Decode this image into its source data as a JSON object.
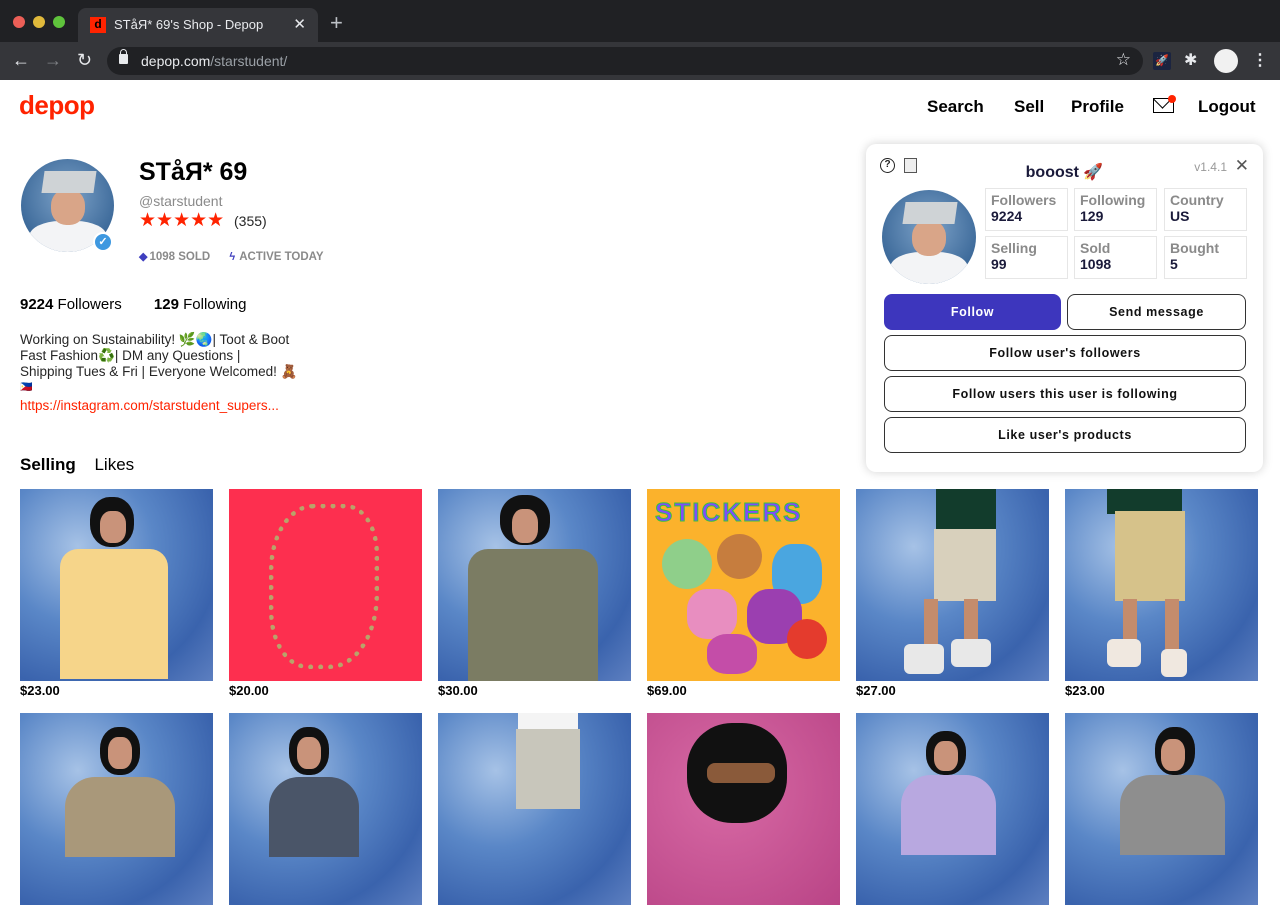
{
  "browser": {
    "tab_title": "STåЯ* 69's Shop - Depop",
    "favicon_letter": "d",
    "url_domain": "depop.com",
    "url_path": "/starstudent/"
  },
  "nav": {
    "logo": "depop",
    "search": "Search",
    "sell": "Sell",
    "profile": "Profile",
    "logout": "Logout",
    "has_unread_messages": true
  },
  "profile": {
    "name": "STåЯ* 69",
    "handle": "@starstudent",
    "rating_stars": 5,
    "stars_display": "★★★★★",
    "reviews": "(355)",
    "sold_badge": "1098 SOLD",
    "active_badge": "ACTIVE TODAY",
    "followers_count": "9224",
    "followers_label": "Followers",
    "following_count": "129",
    "following_label": "Following",
    "bio_lines": [
      "Working on Sustainability! 🌿🌏| Toot & Boot",
      "Fast Fashion♻️| DM any Questions |",
      "Shipping Tues & Fri | Everyone Welcomed! 🧸",
      "🇵🇭"
    ],
    "bio_link": "https://instagram.com/starstudent_supers..."
  },
  "tabs": {
    "selling": "Selling",
    "likes": "Likes"
  },
  "products": [
    {
      "price": "$23.00",
      "image": "floral shirt on blue backdrop"
    },
    {
      "price": "$20.00",
      "image": "chain necklace on red backdrop"
    },
    {
      "price": "$30.00",
      "image": "camo jacket on blue backdrop"
    },
    {
      "price": "$69.00",
      "image": "stickers on orange backdrop"
    },
    {
      "price": "$27.00",
      "image": "cargo shorts on blue backdrop"
    },
    {
      "price": "$23.00",
      "image": "khaki shorts on blue backdrop"
    },
    {
      "price": "",
      "image": "knit sweater on blue backdrop"
    },
    {
      "price": "",
      "image": "grey tee on blue backdrop"
    },
    {
      "price": "",
      "image": "trousers on blue backdrop"
    },
    {
      "price": "",
      "image": "sunglasses on pink backdrop"
    },
    {
      "price": "",
      "image": "lavender sweatshirt on blue backdrop"
    },
    {
      "price": "",
      "image": "grey sweatshirt on blue backdrop"
    }
  ],
  "extension": {
    "title": "booost 🚀",
    "version": "v1.4.1",
    "stats": [
      {
        "label": "Followers",
        "value": "9224"
      },
      {
        "label": "Following",
        "value": "129"
      },
      {
        "label": "Country",
        "value": "US"
      },
      {
        "label": "Selling",
        "value": "99"
      },
      {
        "label": "Sold",
        "value": "1098"
      },
      {
        "label": "Bought",
        "value": "5"
      }
    ],
    "buttons": {
      "follow": "Follow",
      "send_message": "Send message",
      "follow_followers": "Follow user's followers",
      "follow_following": "Follow users this user is following",
      "like_products": "Like user's products"
    },
    "accent_color": "#3d36bd"
  }
}
